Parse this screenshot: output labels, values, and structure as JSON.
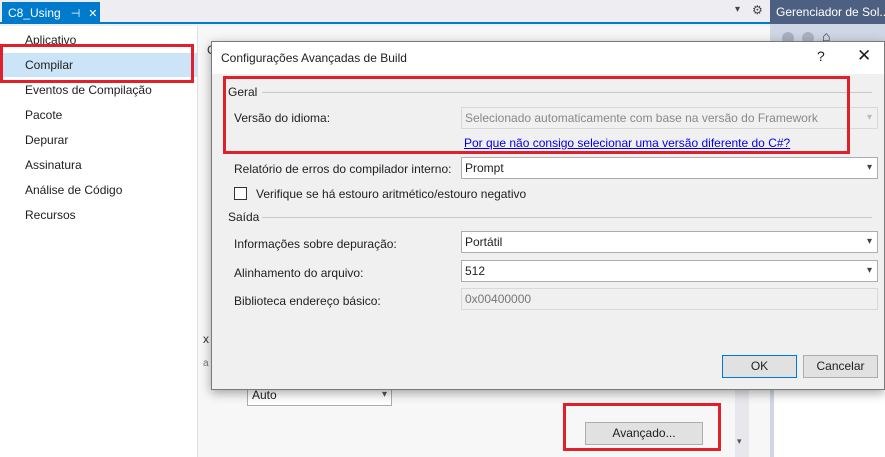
{
  "document_tab": {
    "title": "C8_Using",
    "pin_glyph": "⊣",
    "close_glyph": "✕"
  },
  "tab_overflow_glyph": "▾",
  "tab_gear_glyph": "⚙",
  "nav": {
    "items": [
      {
        "label": "Aplicativo"
      },
      {
        "label": "Compilar"
      },
      {
        "label": "Eventos de Compilação"
      },
      {
        "label": "Pacote"
      },
      {
        "label": "Depurar"
      },
      {
        "label": "Assinatura"
      },
      {
        "label": "Análise de Código"
      },
      {
        "label": "Recursos"
      }
    ],
    "selected_index": 1
  },
  "background_content": {
    "fragment_1": "C",
    "fragment_2": "x",
    "fragment_3": "a",
    "auto_combo_value": "Auto",
    "advanced_button": "Avançado..."
  },
  "solution_explorer": {
    "title": "Gerenciador de Sol..."
  },
  "dialog": {
    "title": "Configurações Avançadas de Build",
    "help_glyph": "?",
    "close_glyph": "✕",
    "general_section": "Geral",
    "language_version_label": "Versão do idioma:",
    "language_version_value": "Selecionado automaticamente com base na versão do Framework",
    "language_version_link": "Por que não consigo selecionar uma versão diferente do C#?",
    "error_report_label": "Relatório de erros do compilador interno:",
    "error_report_value": "Prompt",
    "overflow_check_label": "Verifique se há estouro aritmético/estouro negativo",
    "overflow_checked": false,
    "output_section": "Saída",
    "debug_info_label": "Informações sobre depuração:",
    "debug_info_value": "Portátil",
    "file_alignment_label": "Alinhamento do arquivo:",
    "file_alignment_value": "512",
    "base_address_label": "Biblioteca endereço básico:",
    "base_address_value": "0x00400000",
    "ok_button": "OK",
    "cancel_button": "Cancelar"
  },
  "chevron_glyph": "▾",
  "colors": {
    "accent": "#007acc",
    "highlight": "#e0202a",
    "selected_nav": "#cce4f7",
    "link": "#0000ee"
  }
}
